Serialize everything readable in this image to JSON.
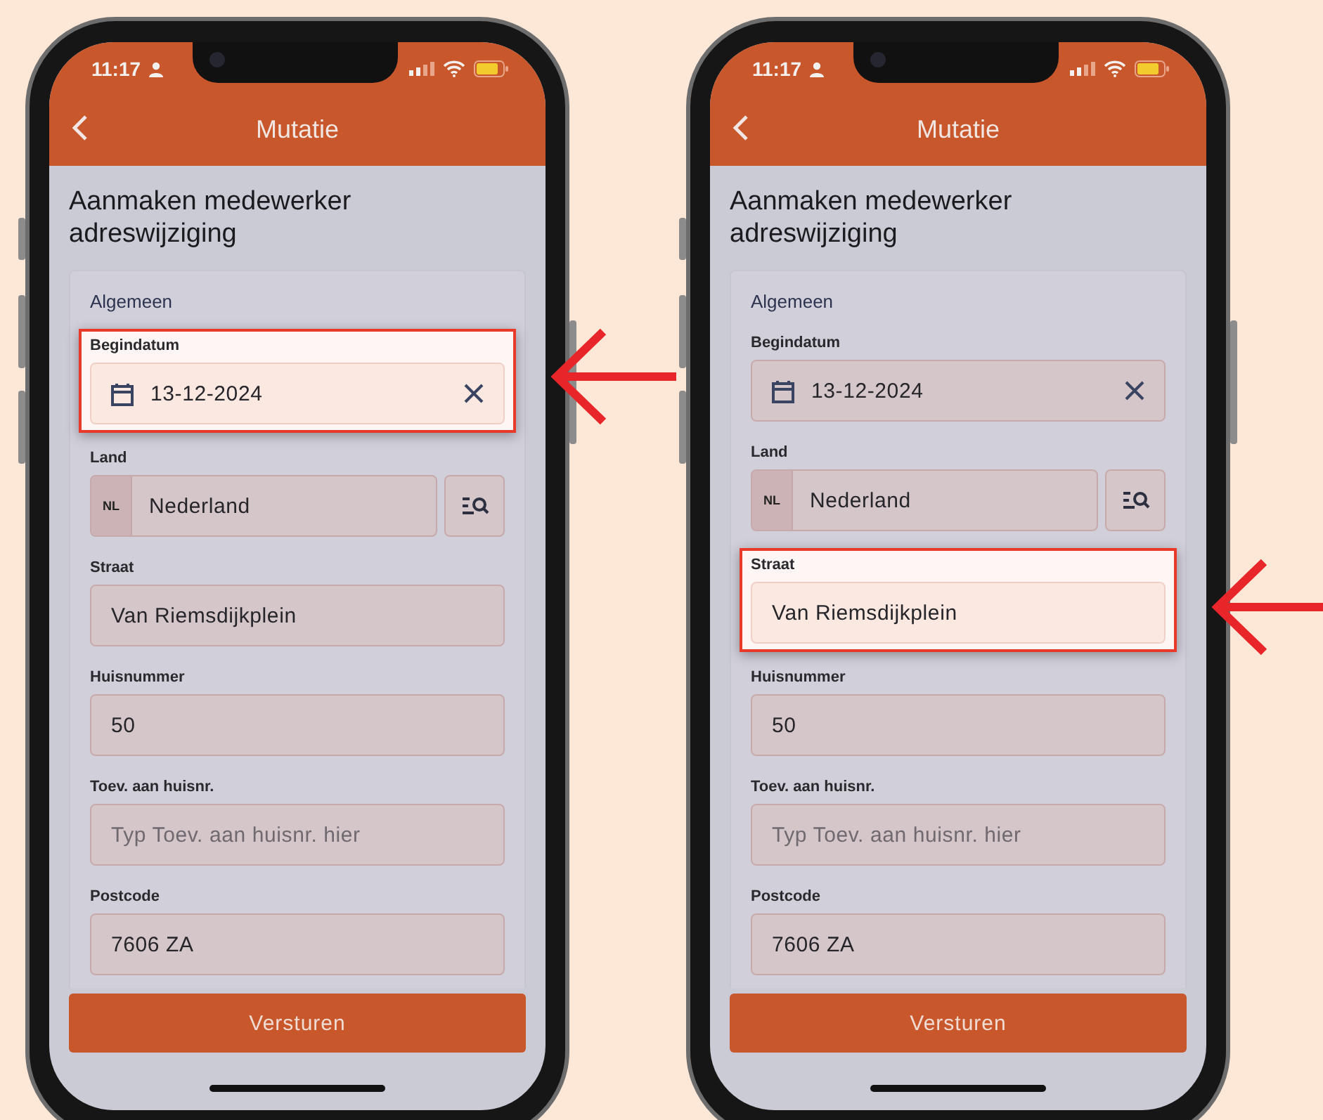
{
  "phones": [
    {
      "status_time": "11:17",
      "header": {
        "title": "Mutatie"
      },
      "heading": "Aanmaken medewerker adreswijziging",
      "section": "Algemeen",
      "fields": [
        {
          "kind": "date",
          "label": "Begindatum",
          "value": "13-12-2024",
          "highlighted": true
        },
        {
          "kind": "lookup",
          "label": "Land",
          "prefix": "NL",
          "value": "Nederland",
          "highlighted": false
        },
        {
          "kind": "text",
          "label": "Straat",
          "value": "Van Riemsdijkplein",
          "highlighted": false
        },
        {
          "kind": "text",
          "label": "Huisnummer",
          "value": "50",
          "highlighted": false
        },
        {
          "kind": "text",
          "label": "Toev. aan huisnr.",
          "placeholder": "Typ Toev. aan huisnr. hier",
          "highlighted": false
        },
        {
          "kind": "text",
          "label": "Postcode",
          "value": "7606 ZA",
          "highlighted": false
        }
      ],
      "submit_button": "Versturen"
    },
    {
      "status_time": "11:17",
      "header": {
        "title": "Mutatie"
      },
      "heading": "Aanmaken medewerker adreswijziging",
      "section": "Algemeen",
      "fields": [
        {
          "kind": "date",
          "label": "Begindatum",
          "value": "13-12-2024",
          "highlighted": false
        },
        {
          "kind": "lookup",
          "label": "Land",
          "prefix": "NL",
          "value": "Nederland",
          "highlighted": false
        },
        {
          "kind": "text",
          "label": "Straat",
          "value": "Van Riemsdijkplein",
          "highlighted": true
        },
        {
          "kind": "text",
          "label": "Huisnummer",
          "value": "50",
          "highlighted": false
        },
        {
          "kind": "text",
          "label": "Toev. aan huisnr.",
          "placeholder": "Typ Toev. aan huisnr. hier",
          "highlighted": false
        },
        {
          "kind": "text",
          "label": "Postcode",
          "value": "7606 ZA",
          "highlighted": false
        }
      ],
      "submit_button": "Versturen"
    }
  ]
}
